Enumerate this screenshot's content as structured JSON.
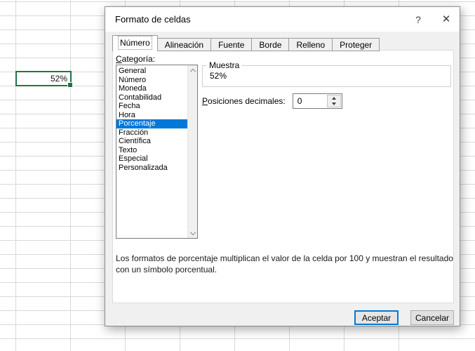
{
  "colors": {
    "accent": "#0078d7",
    "selection_green": "#217346"
  },
  "spreadsheet": {
    "selected_cell_value": "52%"
  },
  "dialog": {
    "title": "Formato de celdas",
    "help_glyph": "?",
    "close_glyph": "✕",
    "tabs": [
      "Número",
      "Alineación",
      "Fuente",
      "Borde",
      "Relleno",
      "Proteger"
    ],
    "active_tab": "Número",
    "category": {
      "label": "Categoría:",
      "items": [
        "General",
        "Número",
        "Moneda",
        "Contabilidad",
        "Fecha",
        "Hora",
        "Porcentaje",
        "Fracción",
        "Científica",
        "Texto",
        "Especial",
        "Personalizada"
      ],
      "selected": "Porcentaje"
    },
    "sample": {
      "label": "Muestra",
      "value": "52%"
    },
    "decimals": {
      "label": "Posiciones decimales:",
      "value": "0"
    },
    "description": "Los formatos de porcentaje multiplican el valor de la celda por 100 y muestran el resultado con un símbolo porcentual.",
    "buttons": {
      "ok": "Aceptar",
      "cancel": "Cancelar"
    }
  }
}
